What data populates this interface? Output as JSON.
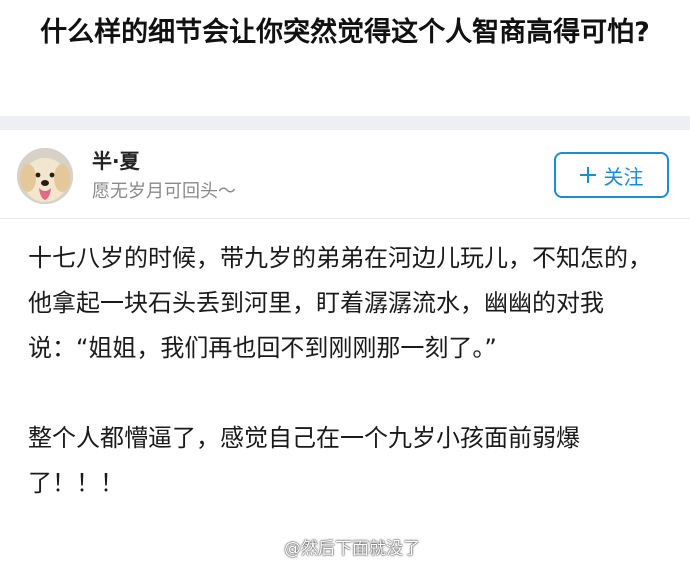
{
  "question": {
    "title": "什么样的细节会让你突然觉得这个人智商高得可怕?"
  },
  "author": {
    "name": "半·夏",
    "bio": "愿无岁月可回头～"
  },
  "follow_button": {
    "label": "关注"
  },
  "answer": {
    "paragraphs": [
      "十七八岁的时候，带九岁的弟弟在河边儿玩儿，不知怎的，他拿起一块石头丢到河里，盯着潺潺流水，幽幽的对我说：“姐姐，我们再也回不到刚刚那一刻了。”",
      "整个人都懵逼了，感觉自己在一个九岁小孩面前弱爆了！！！"
    ]
  },
  "watermark": {
    "text": "@然后下面就没了"
  }
}
